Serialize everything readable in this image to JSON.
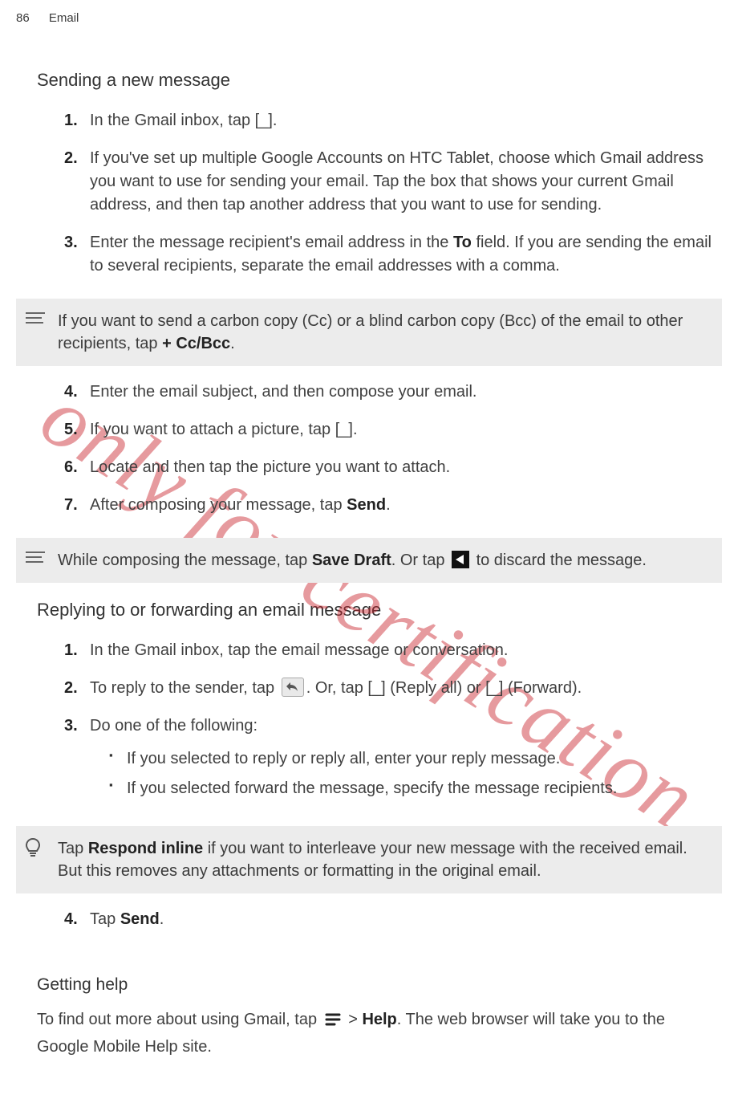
{
  "header": {
    "page_number": "86",
    "section": "Email"
  },
  "watermark": "only for certification",
  "sending": {
    "title": "Sending a new message",
    "steps": {
      "s1a": "In the Gmail inbox, tap ",
      "s1b": ".",
      "s2": "If you've set up multiple Google Accounts on HTC Tablet, choose which Gmail address you want to use for sending your email. Tap the box that shows your current Gmail address, and then tap another address that you want to use for sending.",
      "s3a": "Enter the message recipient's email address in the ",
      "s3b": "To",
      "s3c": " field. If you are sending the email to several recipients, separate the email addresses with a comma.",
      "note1a": "If you want to send a carbon copy (Cc) or a blind carbon copy (Bcc) of the email to other recipients, tap ",
      "note1b": "+ Cc/Bcc",
      "note1c": ".",
      "s4": "Enter the email subject, and then compose your email.",
      "s5a": "If you want to attach a picture, tap ",
      "s5b": ".",
      "s6": "Locate and then tap the picture you want to attach.",
      "s7a": "After composing your message, tap ",
      "s7b": "Send",
      "s7c": ".",
      "note2a": "While composing the message, tap ",
      "note2b": "Save Draft",
      "note2c": ". Or tap ",
      "note2d": " to discard the message."
    }
  },
  "replying": {
    "title": "Replying to or forwarding an email message",
    "steps": {
      "s1": "In the Gmail inbox, tap the email message or conversation.",
      "s2a": "To reply to the sender, tap ",
      "s2b": ". Or, tap ",
      "s2c": " (Reply all) or ",
      "s2d": " (Forward).",
      "s3": "Do one of the following:",
      "sub1": "If you selected to reply or reply all, enter your reply message.",
      "sub2": "If you selected forward the message, specify the message recipients.",
      "note3a": "Tap ",
      "note3b": "Respond inline",
      "note3c": " if you want to interleave your new message with the received email. But this removes any attachments or formatting in the original email.",
      "s4a": "Tap ",
      "s4b": "Send",
      "s4c": "."
    }
  },
  "gettinghelp": {
    "title": "Getting help",
    "body_a": "To find out more about using Gmail, tap ",
    "body_b": " > ",
    "body_c": "Help",
    "body_d": ". The web browser will take you to the Google Mobile Help site."
  }
}
